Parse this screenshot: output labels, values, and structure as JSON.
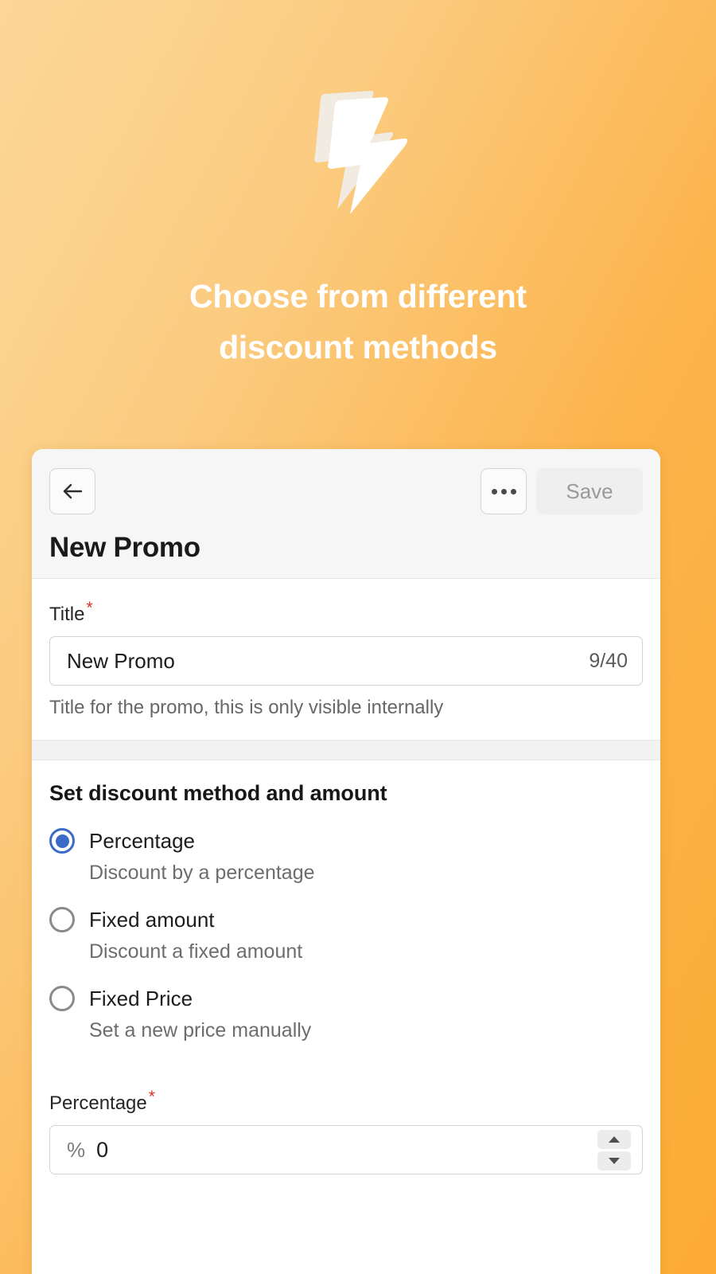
{
  "hero": {
    "icon": "lightning-bolt-icon",
    "title_line1": "Choose from different",
    "title_line2": "discount methods",
    "title_color": "#FFFFFF",
    "gradient_from": "#FCD797",
    "gradient_to": "#FCAC35"
  },
  "card": {
    "header": {
      "back_icon": "arrow-left-icon",
      "more_icon": "ellipsis-horizontal-icon",
      "save_label": "Save",
      "save_disabled": true,
      "page_title": "New Promo",
      "background": "#F6F6F6"
    },
    "title_section": {
      "label": "Title",
      "required_marker": "*",
      "value": "New Promo",
      "counter": "9/40",
      "max_length": 40,
      "help_text": "Title for the promo, this is only visible internally"
    },
    "discount_section": {
      "heading": "Set discount method and amount",
      "selected_method": "percentage",
      "accent_color": "#3A6BC7",
      "options": [
        {
          "id": "percentage",
          "label": "Percentage",
          "description": "Discount by a percentage",
          "selected": true
        },
        {
          "id": "fixed-amount",
          "label": "Fixed amount",
          "description": "Discount a fixed amount",
          "selected": false
        },
        {
          "id": "fixed-price",
          "label": "Fixed Price",
          "description": "Set a new price manually",
          "selected": false
        }
      ],
      "amount_field": {
        "label": "Percentage",
        "required_marker": "*",
        "prefix": "%",
        "value": "0",
        "stepper_up_icon": "caret-up-icon",
        "stepper_down_icon": "caret-down-icon"
      }
    }
  }
}
